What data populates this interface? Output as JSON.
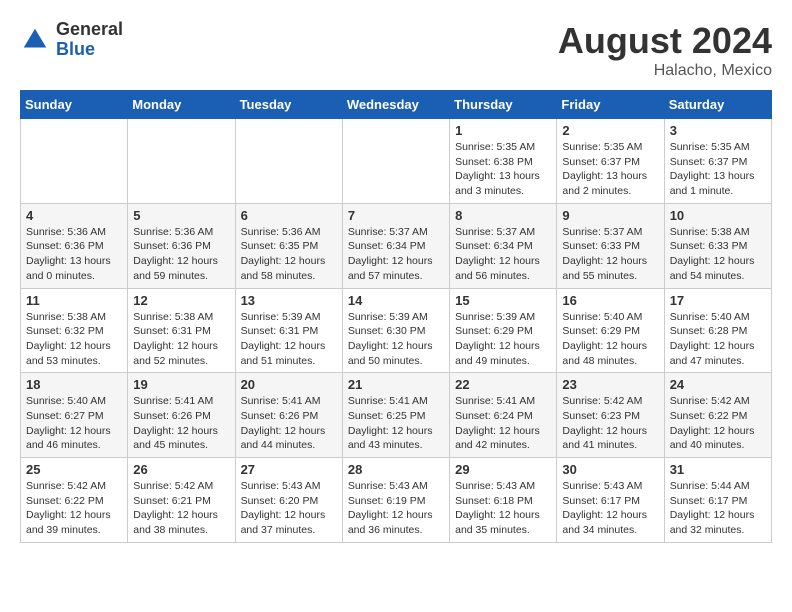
{
  "header": {
    "logo_general": "General",
    "logo_blue": "Blue",
    "month_year": "August 2024",
    "location": "Halacho, Mexico"
  },
  "days_of_week": [
    "Sunday",
    "Monday",
    "Tuesday",
    "Wednesday",
    "Thursday",
    "Friday",
    "Saturday"
  ],
  "weeks": [
    [
      {
        "day": "",
        "info": ""
      },
      {
        "day": "",
        "info": ""
      },
      {
        "day": "",
        "info": ""
      },
      {
        "day": "",
        "info": ""
      },
      {
        "day": "1",
        "info": "Sunrise: 5:35 AM\nSunset: 6:38 PM\nDaylight: 13 hours\nand 3 minutes."
      },
      {
        "day": "2",
        "info": "Sunrise: 5:35 AM\nSunset: 6:37 PM\nDaylight: 13 hours\nand 2 minutes."
      },
      {
        "day": "3",
        "info": "Sunrise: 5:35 AM\nSunset: 6:37 PM\nDaylight: 13 hours\nand 1 minute."
      }
    ],
    [
      {
        "day": "4",
        "info": "Sunrise: 5:36 AM\nSunset: 6:36 PM\nDaylight: 13 hours\nand 0 minutes."
      },
      {
        "day": "5",
        "info": "Sunrise: 5:36 AM\nSunset: 6:36 PM\nDaylight: 12 hours\nand 59 minutes."
      },
      {
        "day": "6",
        "info": "Sunrise: 5:36 AM\nSunset: 6:35 PM\nDaylight: 12 hours\nand 58 minutes."
      },
      {
        "day": "7",
        "info": "Sunrise: 5:37 AM\nSunset: 6:34 PM\nDaylight: 12 hours\nand 57 minutes."
      },
      {
        "day": "8",
        "info": "Sunrise: 5:37 AM\nSunset: 6:34 PM\nDaylight: 12 hours\nand 56 minutes."
      },
      {
        "day": "9",
        "info": "Sunrise: 5:37 AM\nSunset: 6:33 PM\nDaylight: 12 hours\nand 55 minutes."
      },
      {
        "day": "10",
        "info": "Sunrise: 5:38 AM\nSunset: 6:33 PM\nDaylight: 12 hours\nand 54 minutes."
      }
    ],
    [
      {
        "day": "11",
        "info": "Sunrise: 5:38 AM\nSunset: 6:32 PM\nDaylight: 12 hours\nand 53 minutes."
      },
      {
        "day": "12",
        "info": "Sunrise: 5:38 AM\nSunset: 6:31 PM\nDaylight: 12 hours\nand 52 minutes."
      },
      {
        "day": "13",
        "info": "Sunrise: 5:39 AM\nSunset: 6:31 PM\nDaylight: 12 hours\nand 51 minutes."
      },
      {
        "day": "14",
        "info": "Sunrise: 5:39 AM\nSunset: 6:30 PM\nDaylight: 12 hours\nand 50 minutes."
      },
      {
        "day": "15",
        "info": "Sunrise: 5:39 AM\nSunset: 6:29 PM\nDaylight: 12 hours\nand 49 minutes."
      },
      {
        "day": "16",
        "info": "Sunrise: 5:40 AM\nSunset: 6:29 PM\nDaylight: 12 hours\nand 48 minutes."
      },
      {
        "day": "17",
        "info": "Sunrise: 5:40 AM\nSunset: 6:28 PM\nDaylight: 12 hours\nand 47 minutes."
      }
    ],
    [
      {
        "day": "18",
        "info": "Sunrise: 5:40 AM\nSunset: 6:27 PM\nDaylight: 12 hours\nand 46 minutes."
      },
      {
        "day": "19",
        "info": "Sunrise: 5:41 AM\nSunset: 6:26 PM\nDaylight: 12 hours\nand 45 minutes."
      },
      {
        "day": "20",
        "info": "Sunrise: 5:41 AM\nSunset: 6:26 PM\nDaylight: 12 hours\nand 44 minutes."
      },
      {
        "day": "21",
        "info": "Sunrise: 5:41 AM\nSunset: 6:25 PM\nDaylight: 12 hours\nand 43 minutes."
      },
      {
        "day": "22",
        "info": "Sunrise: 5:41 AM\nSunset: 6:24 PM\nDaylight: 12 hours\nand 42 minutes."
      },
      {
        "day": "23",
        "info": "Sunrise: 5:42 AM\nSunset: 6:23 PM\nDaylight: 12 hours\nand 41 minutes."
      },
      {
        "day": "24",
        "info": "Sunrise: 5:42 AM\nSunset: 6:22 PM\nDaylight: 12 hours\nand 40 minutes."
      }
    ],
    [
      {
        "day": "25",
        "info": "Sunrise: 5:42 AM\nSunset: 6:22 PM\nDaylight: 12 hours\nand 39 minutes."
      },
      {
        "day": "26",
        "info": "Sunrise: 5:42 AM\nSunset: 6:21 PM\nDaylight: 12 hours\nand 38 minutes."
      },
      {
        "day": "27",
        "info": "Sunrise: 5:43 AM\nSunset: 6:20 PM\nDaylight: 12 hours\nand 37 minutes."
      },
      {
        "day": "28",
        "info": "Sunrise: 5:43 AM\nSunset: 6:19 PM\nDaylight: 12 hours\nand 36 minutes."
      },
      {
        "day": "29",
        "info": "Sunrise: 5:43 AM\nSunset: 6:18 PM\nDaylight: 12 hours\nand 35 minutes."
      },
      {
        "day": "30",
        "info": "Sunrise: 5:43 AM\nSunset: 6:17 PM\nDaylight: 12 hours\nand 34 minutes."
      },
      {
        "day": "31",
        "info": "Sunrise: 5:44 AM\nSunset: 6:17 PM\nDaylight: 12 hours\nand 32 minutes."
      }
    ]
  ]
}
